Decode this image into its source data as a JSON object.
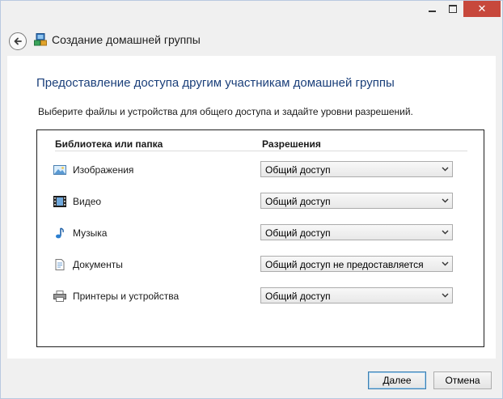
{
  "window": {
    "title": "Создание домашней группы",
    "accent": "#1a3f7a",
    "close_color": "#c7483c"
  },
  "caption_buttons": {
    "minimize": "minimize-icon",
    "maximize": "maximize-icon",
    "close": "close-icon",
    "close_glyph": "✕"
  },
  "content": {
    "heading": "Предоставление доступа другим участникам домашней группы",
    "description": "Выберите файлы и устройства для общего доступа и задайте уровни разрешений."
  },
  "table": {
    "col_library": "Библиотека или папка",
    "col_permissions": "Разрешения",
    "rows": [
      {
        "icon": "pictures-icon",
        "label": "Изображения",
        "permission": "Общий доступ"
      },
      {
        "icon": "video-icon",
        "label": "Видео",
        "permission": "Общий доступ"
      },
      {
        "icon": "music-icon",
        "label": "Музыка",
        "permission": "Общий доступ"
      },
      {
        "icon": "documents-icon",
        "label": "Документы",
        "permission": "Общий доступ не предоставляется"
      },
      {
        "icon": "printer-icon",
        "label": "Принтеры и устройства",
        "permission": "Общий доступ"
      }
    ]
  },
  "buttons": {
    "next": "Далее",
    "cancel": "Отмена"
  }
}
